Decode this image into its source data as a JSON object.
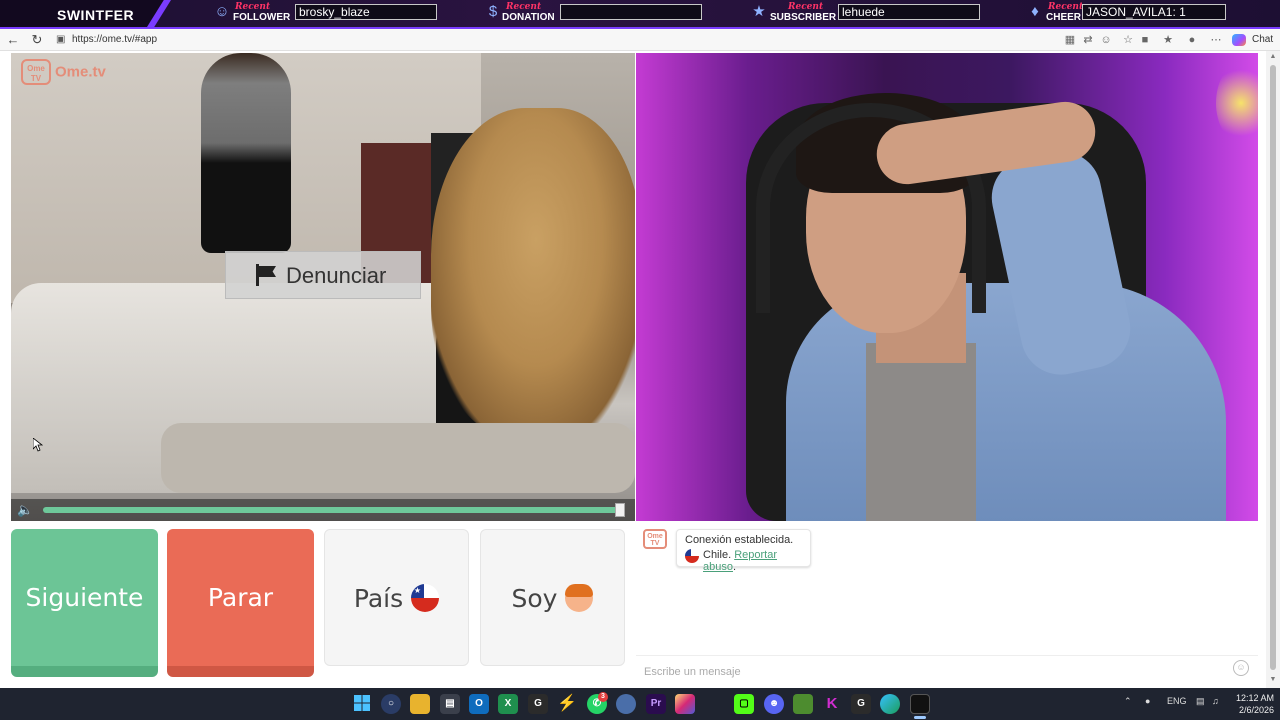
{
  "overlay": {
    "brand": "SWINTFER",
    "recent_label": "Recent",
    "follower": {
      "type": "FOLLOWER",
      "value": "brosky_blaze"
    },
    "donation": {
      "type": "DONATION",
      "value": ""
    },
    "subscriber": {
      "type": "SUBSCRIBER",
      "value": "lehuede"
    },
    "cheer": {
      "type": "CHEER",
      "value": "JASON_AVILA1: 1"
    }
  },
  "browser": {
    "url": "https://ome.tv/#app",
    "chat_label": "Chat"
  },
  "site": {
    "logo_box": "Ome TV",
    "logo_text": "Ome.tv"
  },
  "video": {
    "report_label": "Denunciar",
    "volume_level": 1.0
  },
  "controls": {
    "next_label": "Siguiente",
    "stop_label": "Parar",
    "country_label": "País",
    "gender_label": "Soy"
  },
  "chat": {
    "system_icon": "Ome TV",
    "message_line1": "Conexión establecida.",
    "message_country": "Chile.",
    "report_link": "Reportar abuso",
    "message_end": ".",
    "input_placeholder": "Escribe un mensaje"
  },
  "taskbar": {
    "language": "ENG",
    "time": "12:12 AM",
    "date": "2/6/2026",
    "whatsapp_badge": "3"
  },
  "colors": {
    "next": "#6cc596",
    "stop": "#ea6b56",
    "brand_accent": "#e48d79",
    "link": "#4aa07a",
    "overlay_accent": "#7a3cff"
  }
}
